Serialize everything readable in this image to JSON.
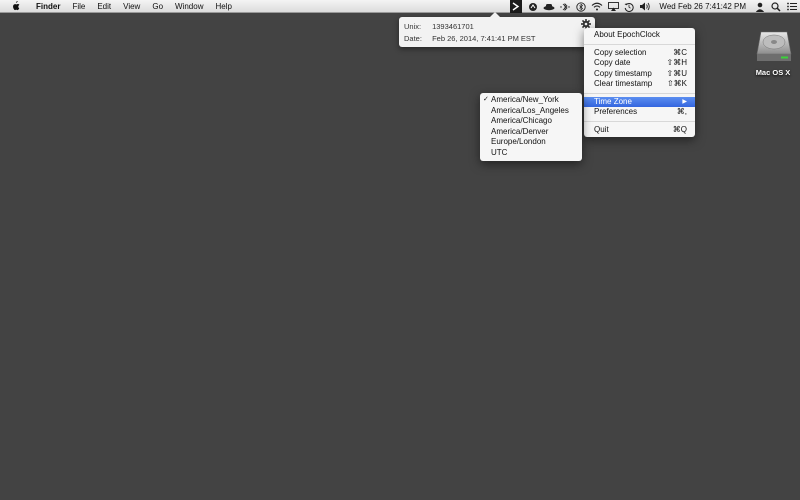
{
  "menubar": {
    "apple_icon": "apple-icon",
    "app_name": "Finder",
    "menus": [
      "File",
      "Edit",
      "View",
      "Go",
      "Window",
      "Help"
    ],
    "clock": "Wed Feb 26  7:41:42 PM",
    "status_icons": [
      "epochclock-icon",
      "cloud-icon",
      "hat-icon",
      "bluetooth-dots-icon",
      "bluetooth-icon",
      "wifi-icon",
      "airplay-icon",
      "time-machine-icon",
      "volume-icon",
      "user-icon",
      "search-icon",
      "list-icon"
    ]
  },
  "popover": {
    "unix_label": "Unix:",
    "unix_value": "1393461701",
    "date_label": "Date:",
    "date_value": "Feb 26, 2014, 7:41:41 PM EST",
    "gear_icon": "gear-icon"
  },
  "main_menu": {
    "about": "About EpochClock",
    "copy_selection": "Copy selection",
    "copy_selection_shortcut": "⌘C",
    "copy_date": "Copy date",
    "copy_date_shortcut": "⇧⌘H",
    "copy_timestamp": "Copy timestamp",
    "copy_timestamp_shortcut": "⇧⌘U",
    "clear_timestamp": "Clear timestamp",
    "clear_timestamp_shortcut": "⇧⌘K",
    "time_zone": "Time Zone",
    "preferences": "Preferences",
    "preferences_shortcut": "⌘,",
    "quit": "Quit",
    "quit_shortcut": "⌘Q"
  },
  "timezone_menu": {
    "checkmark": "✓",
    "items": [
      "America/New_York",
      "America/Los_Angeles",
      "America/Chicago",
      "America/Denver",
      "Europe/London",
      "UTC"
    ],
    "selected": "America/New_York"
  },
  "desktop": {
    "disk_label": "Mac OS X",
    "disk_icon": "hard-disk-icon"
  },
  "colors": {
    "desktop": "#434343",
    "highlight": "#3a6fe2",
    "menu_bg": "#f6f6f6"
  }
}
